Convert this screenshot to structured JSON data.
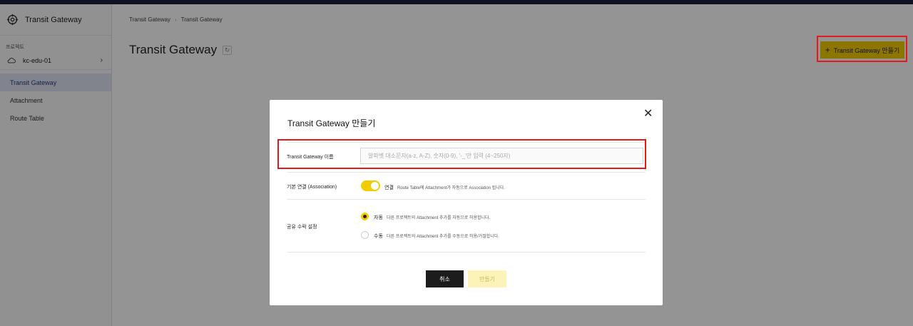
{
  "sidebar": {
    "brand_title": "Transit Gateway",
    "project_label": "프로젝트",
    "project_name": "kc-edu-01",
    "nav": [
      {
        "label": "Transit Gateway",
        "active": true
      },
      {
        "label": "Attachment",
        "active": false
      },
      {
        "label": "Route Table",
        "active": false
      }
    ]
  },
  "breadcrumb": [
    "Transit Gateway",
    "Transit Gateway"
  ],
  "page": {
    "title": "Transit Gateway",
    "create_button": "Transit Gateway 만들기"
  },
  "modal": {
    "title": "Transit Gateway 만들기",
    "name_label": "Transit Gateway 이름",
    "name_placeholder": "알파벳 대소문자(a-z, A-Z), 숫자(0-9), '-_'만 입력 (4~250자)",
    "association_label": "기본 연결 (Association)",
    "association_toggle_label": "연결",
    "association_desc": "Route Table에 Attachment가 자동으로 Association 됩니다.",
    "sharing_label": "공유 수락 설정",
    "sharing_options": [
      {
        "label": "자동",
        "desc": "다른 프로젝트의 Attachment 추가를 자동으로 허용합니다.",
        "selected": true
      },
      {
        "label": "수동",
        "desc": "다른 프로젝트의 Attachment 추가를 수동으로 허용/거절합니다.",
        "selected": false
      }
    ],
    "cancel_button": "취소",
    "submit_button": "만들기"
  },
  "colors": {
    "accent": "#f2cc00",
    "highlight": "#e3191b",
    "topbar": "#1b1f3b"
  }
}
